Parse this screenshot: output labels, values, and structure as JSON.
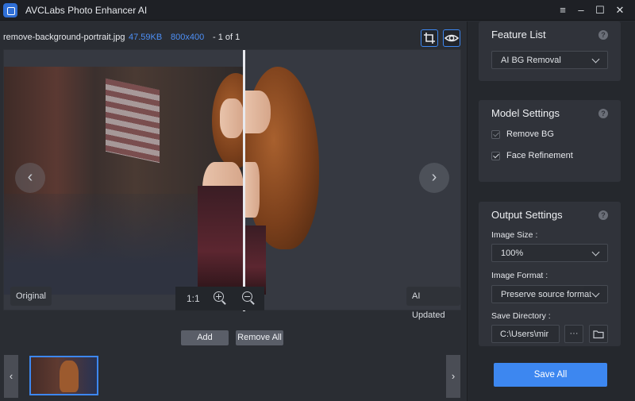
{
  "app": {
    "title": "AVCLabs Photo Enhancer AI",
    "window_controls": [
      "menu-icon",
      "minimize-icon",
      "maximize-icon",
      "close-icon"
    ]
  },
  "file_info": {
    "name": "remove-background-portrait.jpg",
    "size": "47.59KB",
    "dimensions": "800x400",
    "page_indicator": "- 1 of 1"
  },
  "toolbar": {
    "icons": [
      "crop-icon",
      "eye-icon"
    ]
  },
  "preview": {
    "original_label": "Original",
    "updated_label": "AI Updated",
    "zoom_ratio": "1:1",
    "prev_icon": "chevron-left-icon",
    "next_icon": "chevron-right-icon"
  },
  "actions": {
    "add_label": "Add",
    "remove_all_label": "Remove All"
  },
  "thumbnails": {
    "prev_icon": "chevron-left-icon",
    "next_icon": "chevron-right-icon",
    "selected_index": 0
  },
  "side": {
    "feature_list": {
      "title": "Feature List",
      "selected": "AI BG Removal"
    },
    "model_settings": {
      "title": "Model Settings",
      "options": [
        {
          "label": "Remove BG",
          "checked": true,
          "disabled": true
        },
        {
          "label": "Face Refinement",
          "checked": true,
          "disabled": false
        }
      ]
    },
    "output_settings": {
      "title": "Output Settings",
      "image_size_label": "Image Size :",
      "image_size_value": "100%",
      "image_format_label": "Image Format :",
      "image_format_value": "Preserve source format",
      "save_dir_label": "Save Directory :",
      "save_dir_value": "C:\\Users\\mir",
      "browse_label": "···"
    },
    "save_all_label": "Save All"
  },
  "colors": {
    "accent": "#3d87f0",
    "background": "#2a2d33",
    "panel": "#30333a"
  }
}
